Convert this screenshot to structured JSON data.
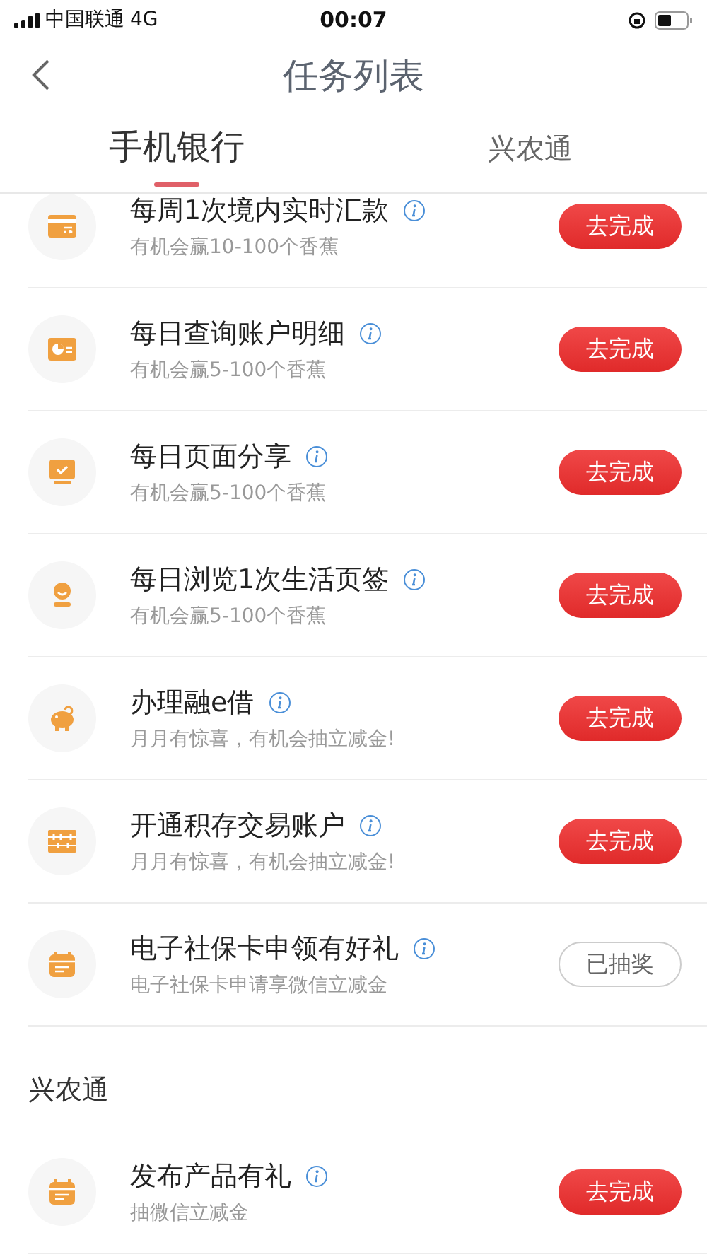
{
  "status_bar": {
    "carrier": "中国联通",
    "network": "4G",
    "time": "00:07"
  },
  "nav": {
    "title": "任务列表"
  },
  "tabs": [
    {
      "label": "手机银行",
      "selected": true
    },
    {
      "label": "兴农通",
      "selected": false
    }
  ],
  "sections": [
    {
      "tasks": [
        {
          "title": "每周1次境内实时汇款",
          "subtitle": "有机会赢10-100个香蕉",
          "button": "去完成",
          "completed": false
        },
        {
          "title": "每日查询账户明细",
          "subtitle": "有机会赢5-100个香蕉",
          "button": "去完成",
          "completed": false
        },
        {
          "title": "每日页面分享",
          "subtitle": "有机会赢5-100个香蕉",
          "button": "去完成",
          "completed": false
        },
        {
          "title": "每日浏览1次生活页签",
          "subtitle": "有机会赢5-100个香蕉",
          "button": "去完成",
          "completed": false
        },
        {
          "title": "办理融e借",
          "subtitle": "月月有惊喜，有机会抽立减金!",
          "button": "去完成",
          "completed": false
        },
        {
          "title": "开通积存交易账户",
          "subtitle": "月月有惊喜，有机会抽立减金!",
          "button": "去完成",
          "completed": false
        },
        {
          "title": "电子社保卡申领有好礼",
          "subtitle": "电子社保卡申请享微信立减金",
          "button": "已抽奖",
          "completed": true
        }
      ]
    },
    {
      "heading": "兴农通",
      "tasks": [
        {
          "title": "发布产品有礼",
          "subtitle": "抽微信立减金",
          "button": "去完成",
          "completed": false
        }
      ]
    }
  ]
}
